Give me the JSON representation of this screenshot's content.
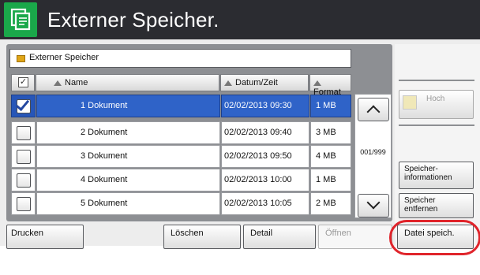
{
  "title_bar": {
    "title": "Externer Speicher.",
    "icon": "copy-pages-icon",
    "colors": {
      "bar": "#2b2c31",
      "icon_bg": "#1aa84a"
    }
  },
  "path": {
    "icon": "folder-icon",
    "label": "Externer Speicher"
  },
  "table": {
    "select_all_checked": true,
    "columns": [
      {
        "label": "Name",
        "sort": "ascending"
      },
      {
        "label": "Datum/Zeit",
        "sort": "ascending"
      },
      {
        "label": "Format",
        "sort": "ascending"
      }
    ],
    "rows": [
      {
        "checked": true,
        "selected": true,
        "name": "1 Dokument",
        "date": "02/02/2013 09:30",
        "size": "1 MB"
      },
      {
        "checked": false,
        "selected": false,
        "name": "2 Dokument",
        "date": "02/02/2013 09:40",
        "size": "3 MB"
      },
      {
        "checked": false,
        "selected": false,
        "name": "3 Dokument",
        "date": "02/02/2013 09:50",
        "size": "4 MB"
      },
      {
        "checked": false,
        "selected": false,
        "name": "4 Dokument",
        "date": "02/02/2013 10:00",
        "size": "1 MB"
      },
      {
        "checked": false,
        "selected": false,
        "name": "5 Dokument",
        "date": "02/02/2013 10:05",
        "size": "2 MB"
      }
    ],
    "selection_color": "#2f63c8"
  },
  "scroll": {
    "page_count": "001/999",
    "up_icon": "chevron-up-icon",
    "down_icon": "chevron-down-icon"
  },
  "side_buttons": {
    "hoch": {
      "label": "Hoch",
      "enabled": false,
      "icon": "folder-up-icon"
    },
    "info": {
      "line1": "Speicher-",
      "line2": "informationen"
    },
    "remove": {
      "line1": "Speicher",
      "line2": "entfernen"
    }
  },
  "bottom_buttons": {
    "print": "Drucken",
    "delete": "Löschen",
    "detail": "Detail",
    "open": "Öffnen",
    "open_enabled": false,
    "save": "Datei speich."
  },
  "annotation": {
    "highlight_color": "#e0242b",
    "highlighted": "Datei speich."
  }
}
